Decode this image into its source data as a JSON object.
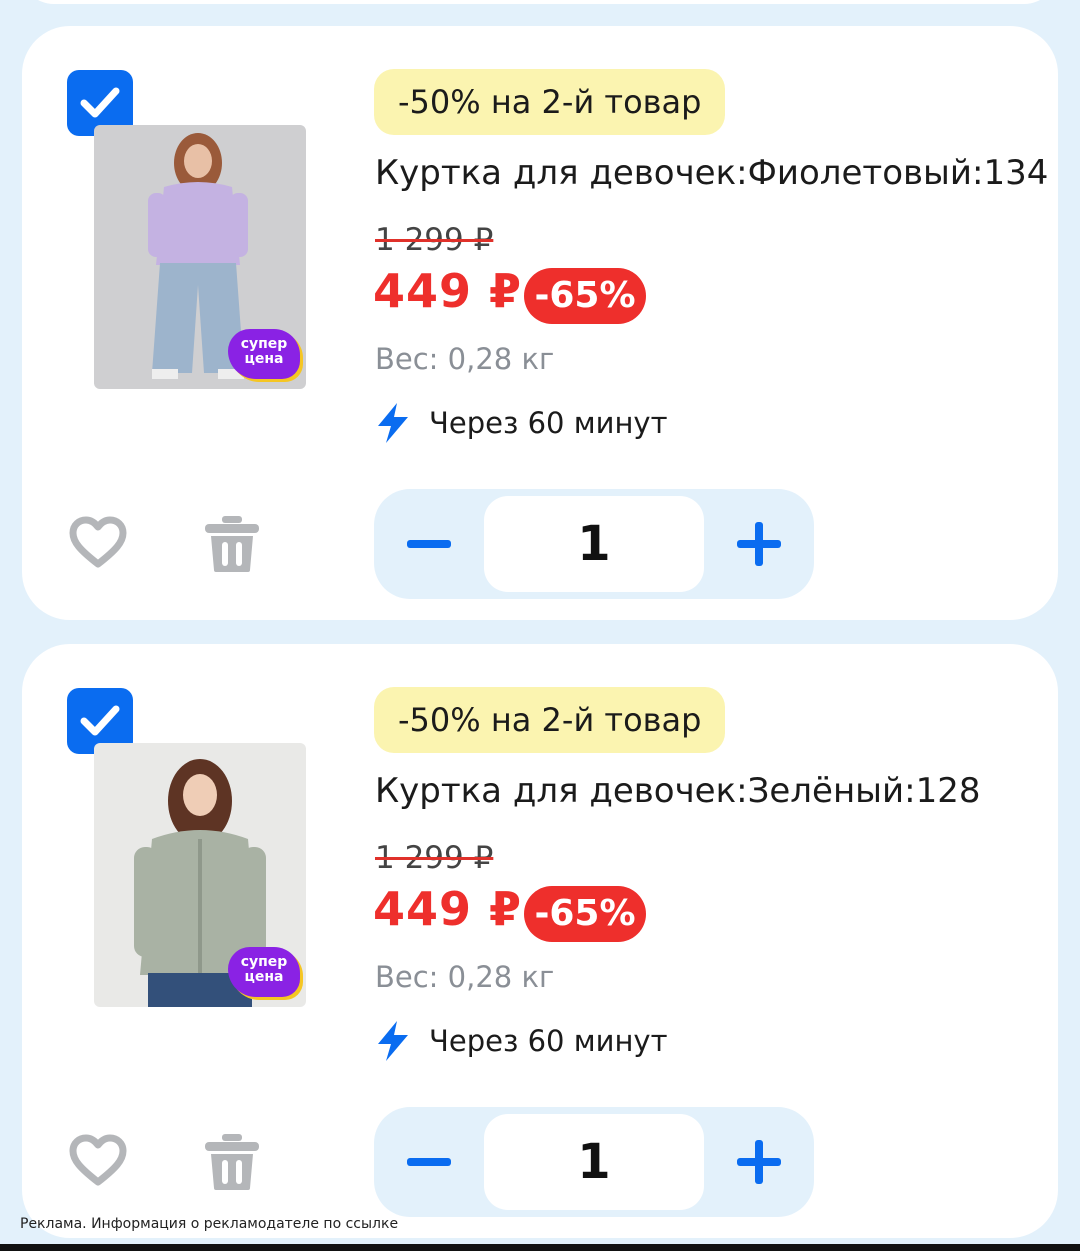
{
  "cart_items": [
    {
      "checked": true,
      "promo": "-50% на 2-й товар",
      "title": "Куртка для девочек:Фиолетовый:134",
      "old_price": "1 299 ₽",
      "price": "449 ₽",
      "discount": "-65%",
      "weight": "Вес: 0,28 кг",
      "delivery": "Через 60 минут",
      "quantity": "1",
      "badge_line1": "супер",
      "badge_line2": "цена",
      "jacket_color": "#c4b2e2"
    },
    {
      "checked": true,
      "promo": "-50% на 2-й товар",
      "title": "Куртка для девочек:Зелёный:128",
      "old_price": "1 299 ₽",
      "price": "449 ₽",
      "discount": "-65%",
      "weight": "Вес: 0,28 кг",
      "delivery": "Через 60 минут",
      "quantity": "1",
      "badge_line1": "супер",
      "badge_line2": "цена",
      "jacket_color": "#a9b2a4"
    }
  ],
  "ad_note": "Реклама. Информация о рекламодателе по ссылке",
  "colors": {
    "accent": "#0a6cf0",
    "price_red": "#ee2f2c",
    "promo_bg": "#fbf4b0",
    "page_bg": "#e3f1fb"
  },
  "icons": [
    "checkmark-icon",
    "lightning-icon",
    "heart-icon",
    "trash-icon",
    "minus-icon",
    "plus-icon"
  ]
}
